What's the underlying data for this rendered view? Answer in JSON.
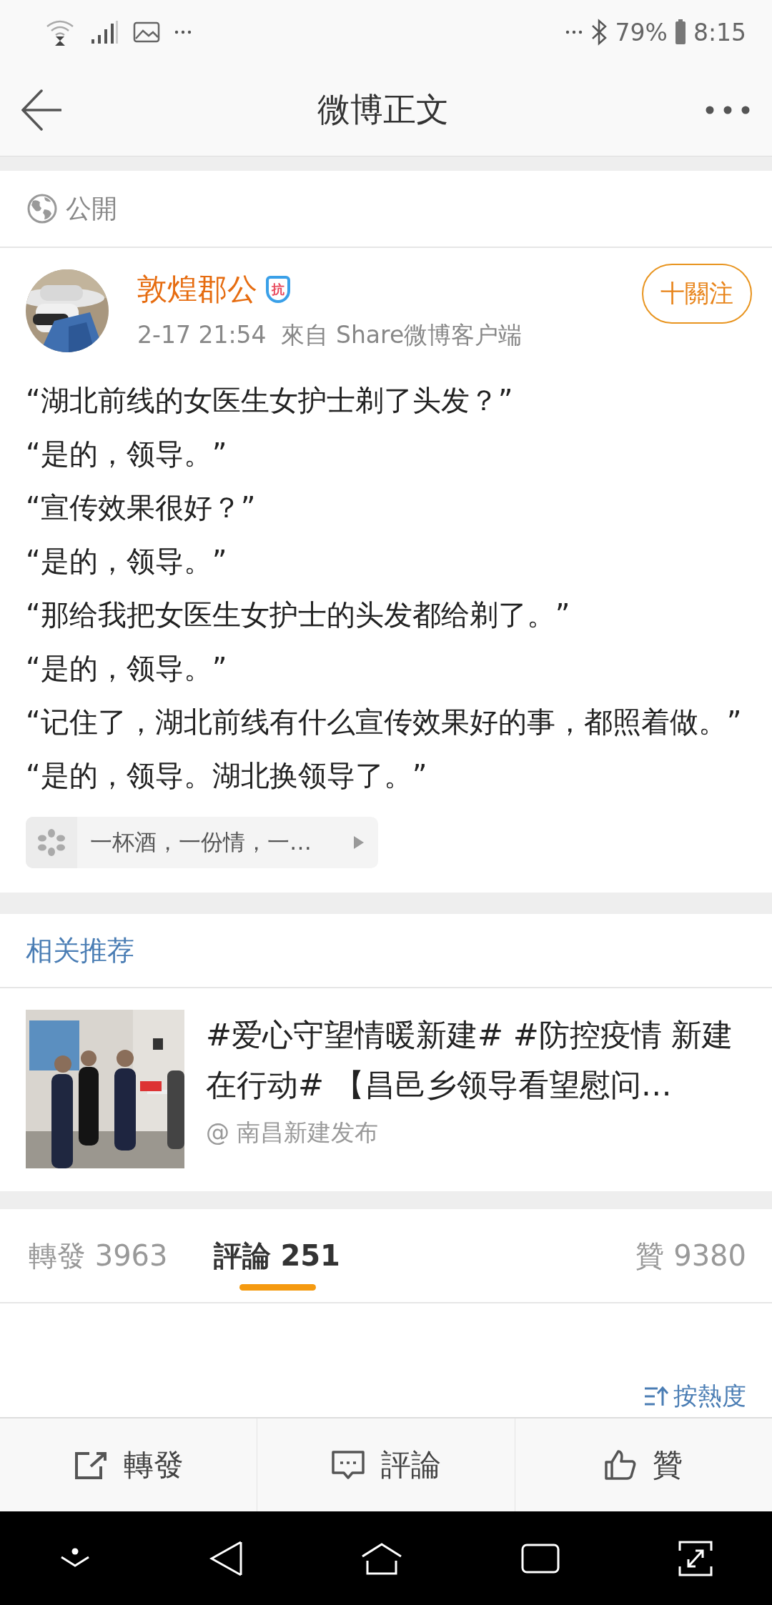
{
  "status_bar": {
    "battery": "79%",
    "time": "8:15"
  },
  "header": {
    "title": "微博正文"
  },
  "visibility": {
    "label": "公開"
  },
  "post": {
    "author": "敦煌郡公",
    "badge": "抗",
    "follow_button": "十關注",
    "meta": "2-17 21:54  來自 Share微博客户端",
    "lines": [
      "“湖北前线的女医生女护士剃了头发？”",
      "“是的，领导。”",
      "“宣传效果很好？”",
      "“是的，领导。”",
      "“那给我把女医生女护士的头发都给剃了。”",
      "“是的，领导。”",
      "“记住了，湖北前线有什么宣传效果好的事，都照着做。”",
      "“是的，领导。湖北换领导了。”"
    ],
    "music_chip": "一杯酒，一份情，一…"
  },
  "related": {
    "heading": "相关推荐",
    "card": {
      "text": "#爱心守望情暖新建# #防控疫情 新建在行动# 【昌邑乡领导看望慰问…",
      "source": "@ 南昌新建发布"
    }
  },
  "tabs": [
    {
      "label": "轉發",
      "count": "3963",
      "selected": false
    },
    {
      "label": "評論",
      "count": "251",
      "selected": true
    },
    {
      "label": "贊",
      "count": "9380",
      "selected": false
    }
  ],
  "sort": {
    "label": "按熱度"
  },
  "actions": [
    {
      "kind": "repost",
      "label": "轉發"
    },
    {
      "kind": "comment",
      "label": "評論"
    },
    {
      "kind": "like",
      "label": "贊"
    }
  ]
}
